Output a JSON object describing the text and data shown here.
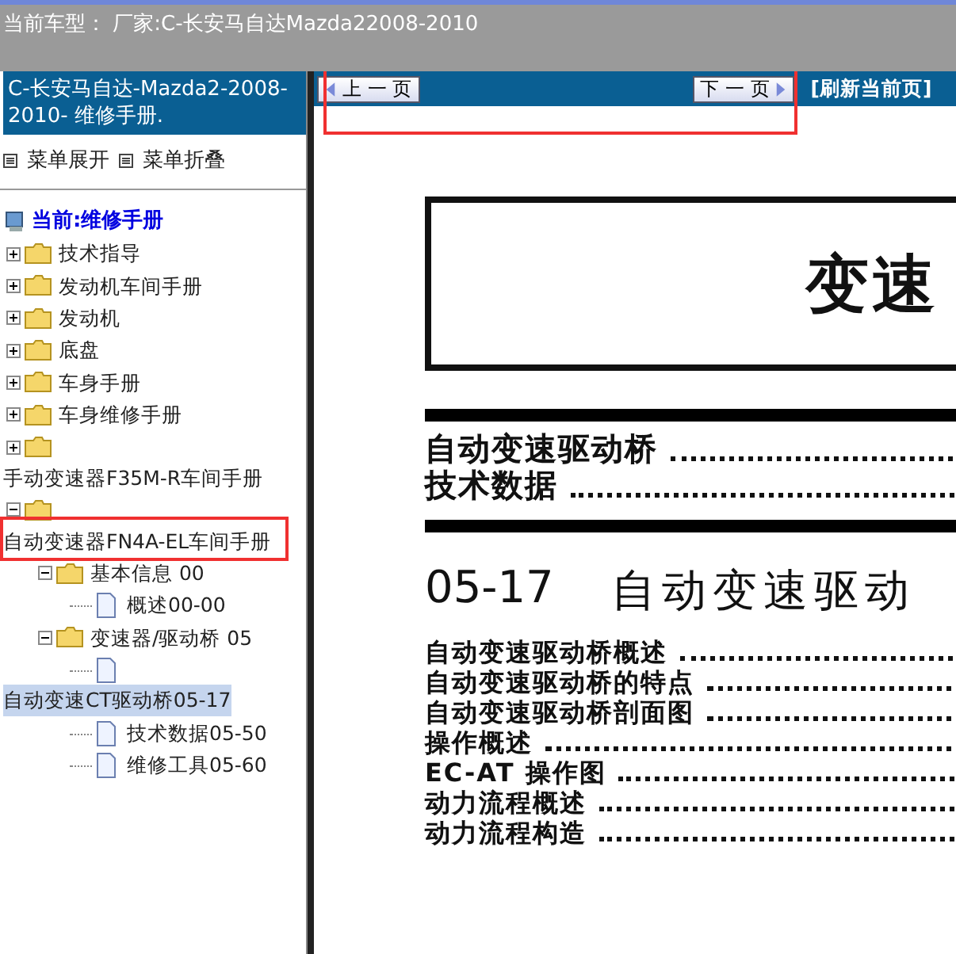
{
  "header": {
    "text": "当前车型： 厂家:C-长安马自达Mazda22008-2010"
  },
  "sidebar": {
    "title": "C-长安马自达-Mazda2-2008-2010- 维修手册.",
    "menu_links": [
      {
        "label": "菜单展开"
      },
      {
        "label": "菜单折叠"
      }
    ],
    "tree": {
      "label": "当前:维修手册",
      "children": [
        {
          "label": "技术指导",
          "kind": "folder",
          "expanded": false,
          "selected": false
        },
        {
          "label": "发动机车间手册",
          "kind": "folder",
          "expanded": false,
          "selected": false
        },
        {
          "label": "发动机",
          "kind": "folder",
          "expanded": false,
          "selected": false
        },
        {
          "label": "底盘",
          "kind": "folder",
          "expanded": false,
          "selected": false
        },
        {
          "label": "车身手册",
          "kind": "folder",
          "expanded": false,
          "selected": false
        },
        {
          "label": "车身维修手册",
          "kind": "folder",
          "expanded": false,
          "selected": false
        },
        {
          "label": "手动变速器F35M-R车间手册",
          "kind": "folder",
          "expanded": false,
          "selected": false
        },
        {
          "label": "自动变速器FN4A-EL车间手册",
          "kind": "folder",
          "expanded": true,
          "selected": false,
          "children": [
            {
              "label": "基本信息 00",
              "kind": "folder",
              "expanded": true,
              "selected": false,
              "children": [
                {
                  "label": "概述00-00",
                  "kind": "doc",
                  "selected": false
                }
              ]
            },
            {
              "label": "变速器/驱动桥 05",
              "kind": "folder",
              "expanded": true,
              "selected": false,
              "children": [
                {
                  "label": "自动变速CT驱动桥05-17",
                  "kind": "doc",
                  "selected": true
                },
                {
                  "label": "技术数据05-50",
                  "kind": "doc",
                  "selected": false
                },
                {
                  "label": "维修工具05-60",
                  "kind": "doc",
                  "selected": false
                }
              ]
            }
          ]
        }
      ]
    }
  },
  "nav": {
    "prev": "上 一 页",
    "next": "下 一 页",
    "refresh": "[刷新当前页]"
  },
  "document": {
    "title": "变速",
    "toc_top": [
      "自动变速驱动桥",
      "技术数据"
    ],
    "section_number": "05-17",
    "section_title": "自动变速驱动",
    "toc": [
      "自动变速驱动桥概述",
      "自动变速驱动桥的特点",
      "自动变速驱动桥剖面图",
      "操作概述",
      "EC-AT 操作图",
      "动力流程概述",
      "动力流程构造"
    ]
  }
}
